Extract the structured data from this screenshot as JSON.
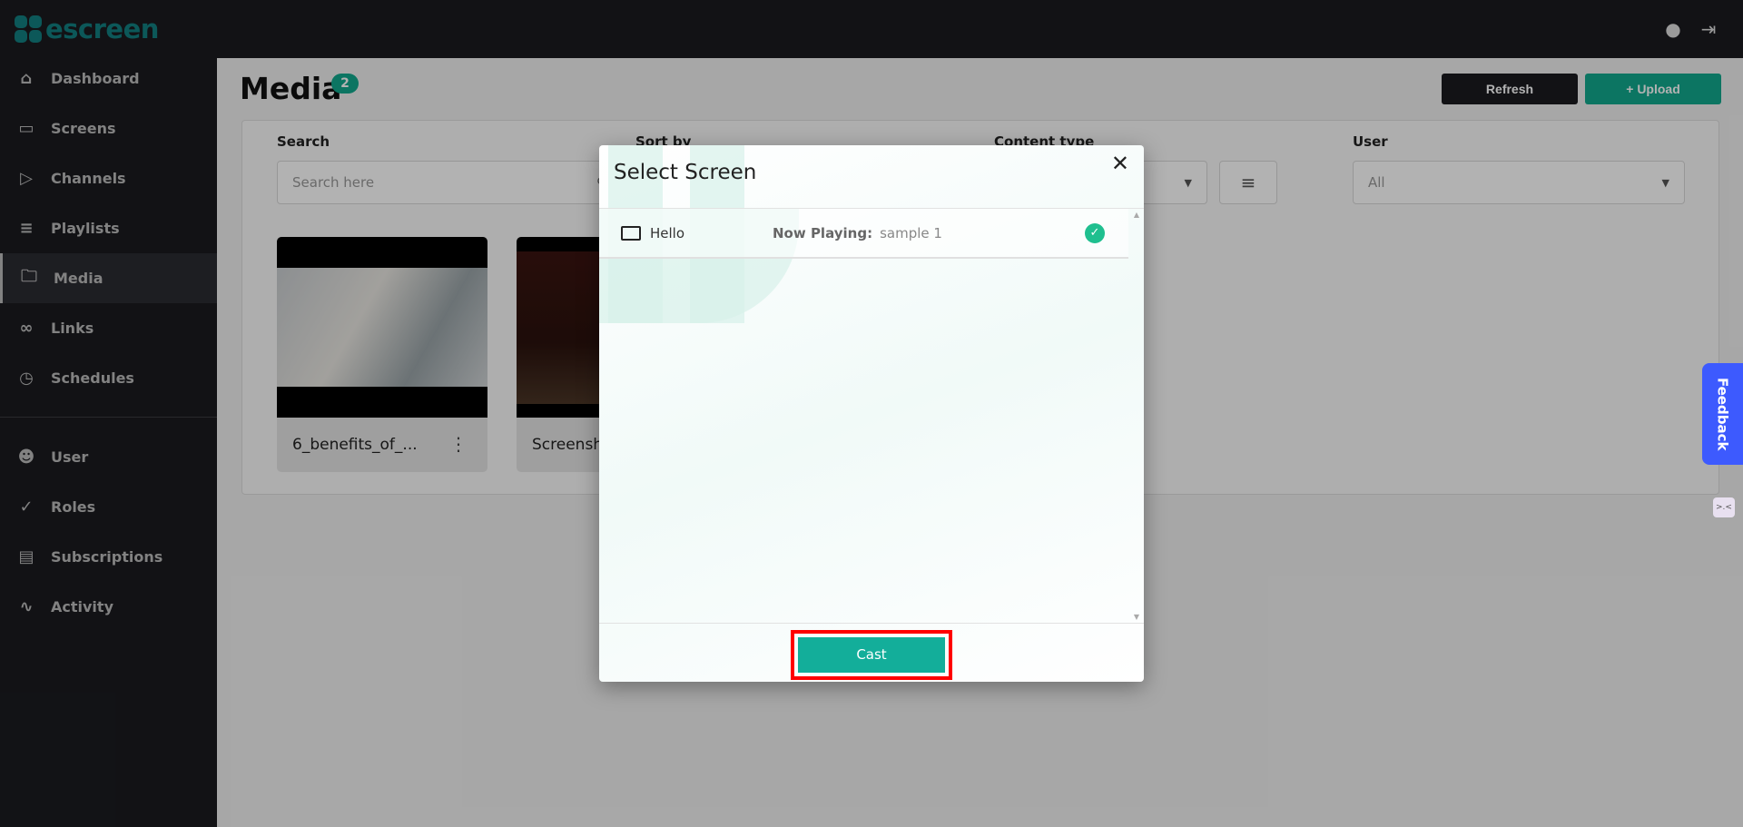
{
  "brand": {
    "name": "escreen",
    "color": "#127f80"
  },
  "topbar": {
    "account_icon": "account-circle-icon",
    "logout_icon": "logout-icon"
  },
  "sidebar": {
    "items": [
      {
        "label": "Dashboard",
        "icon": "home-icon"
      },
      {
        "label": "Screens",
        "icon": "monitor-icon"
      },
      {
        "label": "Channels",
        "icon": "tv-icon"
      },
      {
        "label": "Playlists",
        "icon": "playlist-icon"
      },
      {
        "label": "Media",
        "icon": "folder-icon",
        "active": true
      },
      {
        "label": "Links",
        "icon": "link-icon"
      },
      {
        "label": "Schedules",
        "icon": "clock-icon"
      },
      {
        "label": "User",
        "icon": "users-icon"
      },
      {
        "label": "Roles",
        "icon": "user-check-icon"
      },
      {
        "label": "Subscriptions",
        "icon": "card-icon"
      },
      {
        "label": "Activity",
        "icon": "activity-icon"
      }
    ]
  },
  "page": {
    "title": "Media",
    "count": "2",
    "refresh_label": "Refresh",
    "upload_label": "Upload",
    "upload_color": "#12a88d"
  },
  "filters": {
    "search_label": "Search",
    "search_placeholder": "Search here",
    "sort_label": "Sort by",
    "content_type_label": "Content type",
    "user_label": "User",
    "user_value": "All"
  },
  "media": [
    {
      "name": "6_benefits_of_..."
    },
    {
      "name": "Screensh"
    }
  ],
  "modal": {
    "title": "Select Screen",
    "screens": [
      {
        "name": "Hello",
        "now_playing_label": "Now Playing:",
        "now_playing": "sample 1",
        "selected": true
      }
    ],
    "cast_label": "Cast",
    "accent": "#13ae9a"
  },
  "feedback_label": "Feedback"
}
